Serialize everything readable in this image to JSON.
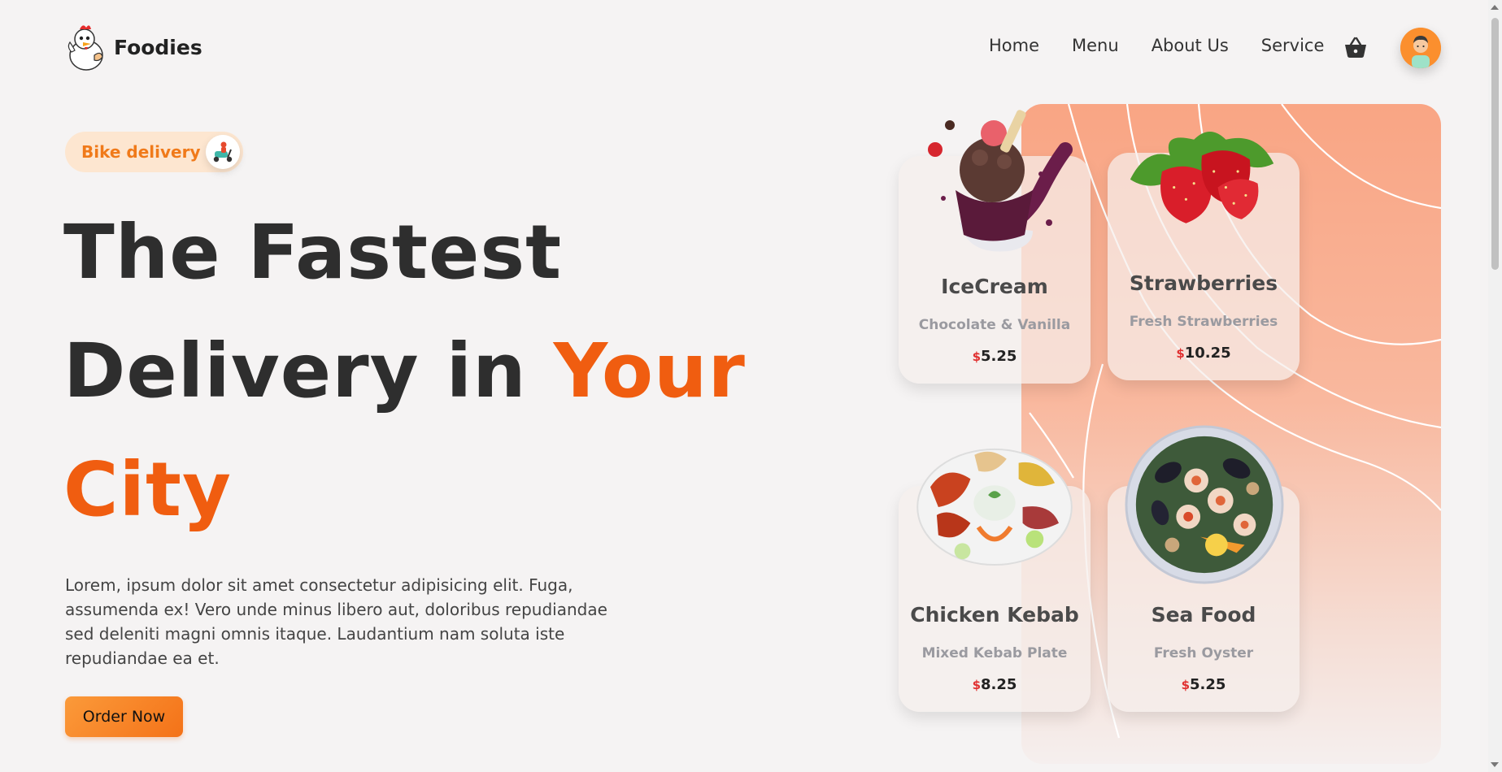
{
  "brand": {
    "name": "Foodies",
    "logo_icon": "chicken-mascot-icon"
  },
  "nav": {
    "items": [
      "Home",
      "Menu",
      "About Us",
      "Service"
    ]
  },
  "header": {
    "cart_icon": "basket-icon",
    "avatar_icon": "user-avatar-icon"
  },
  "hero": {
    "badge_label": "Bike delivery",
    "badge_icon": "delivery-scooter-icon",
    "headline_line1": "The Fastest",
    "headline_line2_dark": "Delivery in ",
    "headline_line2_accent": "Your",
    "headline_line3_accent": "City",
    "description": "Lorem, ipsum dolor sit amet consectetur adipisicing elit. Fuga, assumenda ex! Vero unde minus libero aut, doloribus repudiandae sed deleniti magni omnis itaque. Laudantium nam soluta iste repudiandae ea et.",
    "cta_label": "Order Now"
  },
  "menu_cards": [
    {
      "title": "IceCream",
      "subtitle": "Chocolate & Vanilla",
      "currency": "$",
      "price": "5.25",
      "image_icon": "ice-cream-image"
    },
    {
      "title": "Strawberries",
      "subtitle": "Fresh Strawberries",
      "currency": "$",
      "price": "10.25",
      "image_icon": "strawberries-image"
    },
    {
      "title": "Chicken Kebab",
      "subtitle": "Mixed Kebab Plate",
      "currency": "$",
      "price": "8.25",
      "image_icon": "kebab-plate-image"
    },
    {
      "title": "Sea Food",
      "subtitle": "Fresh Oyster",
      "currency": "$",
      "price": "5.25",
      "image_icon": "seafood-plate-image"
    }
  ],
  "colors": {
    "accent": "#f05d10",
    "badge_bg": "#fde6d0",
    "button": "#f98a2a",
    "price_currency": "#e03030"
  }
}
